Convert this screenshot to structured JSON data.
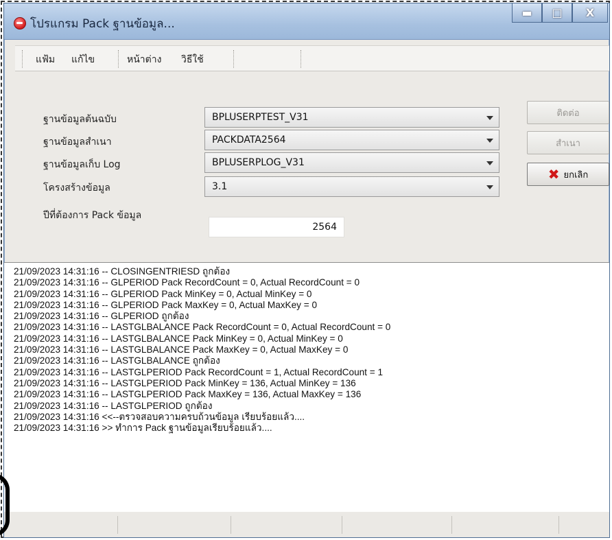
{
  "window": {
    "title": "โปรแกรม Pack ฐานข้อมูล...",
    "controls": {
      "minimize": "▬",
      "maximize": "□",
      "close": "X"
    }
  },
  "menu": {
    "items": [
      "แฟ้ม",
      "แก้ไข",
      "หน้าต่าง",
      "วิธีใช้"
    ]
  },
  "form": {
    "source_db_label": "ฐานข้อมูลต้นฉบับ",
    "source_db_value": "BPLUSERPTEST_V31",
    "copy_db_label": "ฐานข้อมูลสำเนา",
    "copy_db_value": "PACKDATA2564",
    "log_db_label": "ฐานข้อมูลเก็บ Log",
    "log_db_value": "BPLUSERPLOG_V31",
    "structure_label": "โครงสร้างข้อมูล",
    "structure_value": "3.1",
    "year_label": "ปีที่ต้องการ Pack ข้อมูล",
    "year_value": "2564"
  },
  "buttons": {
    "connect": "ติดต่อ",
    "copy": "สำเนา",
    "cancel": "ยกเลิก"
  },
  "log": [
    "21/09/2023 14:31:16 -- CLOSINGENTRIESD ถูกต้อง",
    "21/09/2023 14:31:16 -- GLPERIOD Pack RecordCount = 0, Actual RecordCount = 0",
    "21/09/2023 14:31:16 -- GLPERIOD Pack MinKey = 0, Actual MinKey = 0",
    "21/09/2023 14:31:16 -- GLPERIOD Pack MaxKey = 0, Actual MaxKey = 0",
    "21/09/2023 14:31:16 -- GLPERIOD ถูกต้อง",
    "21/09/2023 14:31:16 -- LASTGLBALANCE Pack RecordCount = 0, Actual RecordCount = 0",
    "21/09/2023 14:31:16 -- LASTGLBALANCE Pack MinKey = 0, Actual MinKey = 0",
    "21/09/2023 14:31:16 -- LASTGLBALANCE Pack MaxKey = 0, Actual MaxKey = 0",
    "21/09/2023 14:31:16 -- LASTGLBALANCE ถูกต้อง",
    "21/09/2023 14:31:16 -- LASTGLPERIOD Pack RecordCount = 1, Actual RecordCount = 1",
    "21/09/2023 14:31:16 -- LASTGLPERIOD Pack MinKey = 136, Actual MinKey = 136",
    "21/09/2023 14:31:16 -- LASTGLPERIOD Pack MaxKey = 136, Actual MaxKey = 136",
    "21/09/2023 14:31:16 -- LASTGLPERIOD ถูกต้อง",
    "21/09/2023 14:31:16 <<--ตรวจสอบความครบถ้วนข้อมูล เรียบร้อยแล้ว....",
    "21/09/2023 14:31:16 >> ทำการ Pack ฐานข้อมูลเรียบร้อยแล้ว...."
  ]
}
